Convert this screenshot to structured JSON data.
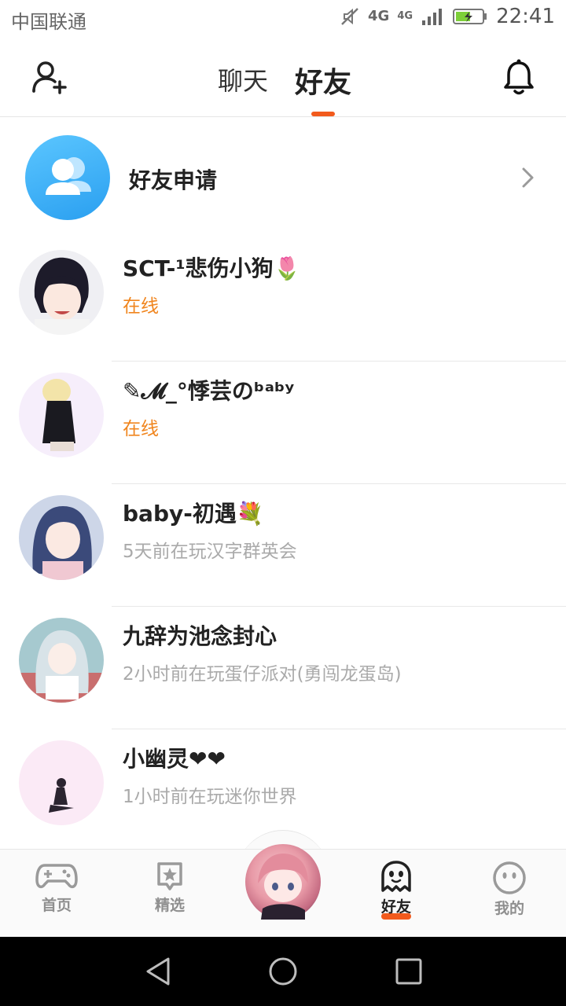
{
  "status_bar": {
    "carrier": "中国联通",
    "network_1": "4G",
    "network_2": "4G",
    "time": "22:41"
  },
  "top_nav": {
    "tabs": [
      {
        "label": "聊天",
        "active": false
      },
      {
        "label": "好友",
        "active": true
      }
    ],
    "accent_color": "#f25a1c"
  },
  "friend_request": {
    "label": "好友申请"
  },
  "friends": [
    {
      "name": "SCT-¹悲伤小狗🌷",
      "status": "在线",
      "online": true
    },
    {
      "name": "✎𝓜_°悸芸のᵇᵃᵇʸ",
      "status": "在线",
      "online": true
    },
    {
      "name": "baby-初遇💐",
      "status": "5天前在玩汉字群英会",
      "online": false
    },
    {
      "name": "九辞为池念封心",
      "status": "2小时前在玩蛋仔派对(勇闯龙蛋岛)",
      "online": false
    },
    {
      "name": "小幽灵❤❤",
      "status": "1小时前在玩迷你世界",
      "online": false
    }
  ],
  "bottom_nav": {
    "items": [
      {
        "label": "首页",
        "icon": "gamepad-icon"
      },
      {
        "label": "精选",
        "icon": "star-card-icon"
      },
      {
        "label": "好友",
        "icon": "ghost-icon",
        "active": true
      },
      {
        "label": "我的",
        "icon": "smiley-icon"
      }
    ]
  }
}
